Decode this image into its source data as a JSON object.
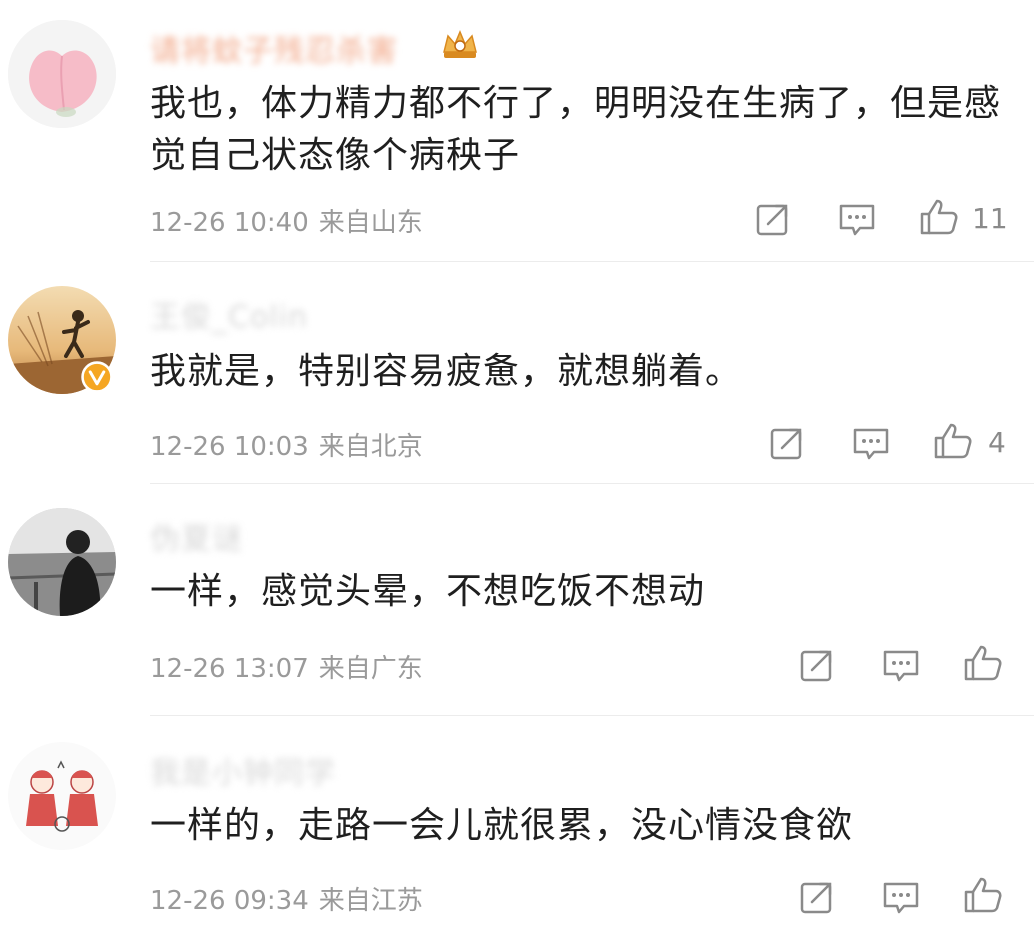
{
  "comments": [
    {
      "username": "请将蚊子残忍杀害",
      "text": "我也，体力精力都不行了，明明没在生病了，但是感觉自己状态像个病秧子",
      "time": "12-26 10:40",
      "location": "来自山东",
      "likes": "11"
    },
    {
      "username": "王俊_Colin",
      "text": "我就是，特别容易疲惫，就想躺着。",
      "time": "12-26 10:03",
      "location": "来自北京",
      "likes": "4"
    },
    {
      "username": "伪夏谜",
      "text": "一样，感觉头晕，不想吃饭不想动",
      "time": "12-26 13:07",
      "location": "来自广东",
      "likes": ""
    },
    {
      "username": "我是小钟同学",
      "text": "一样的，走路一会儿就很累，没心情没食欲",
      "time": "12-26 09:34",
      "location": "来自江苏",
      "likes": ""
    }
  ],
  "icons": {
    "repost": "repost-icon",
    "comment": "comment-icon",
    "like": "thumbs-up-icon"
  },
  "colors": {
    "text": "#1f1f1f",
    "meta": "#9a9a9a",
    "icon": "#8a8a8a",
    "divider": "#ececec",
    "verified_badge": "#f5a623"
  }
}
